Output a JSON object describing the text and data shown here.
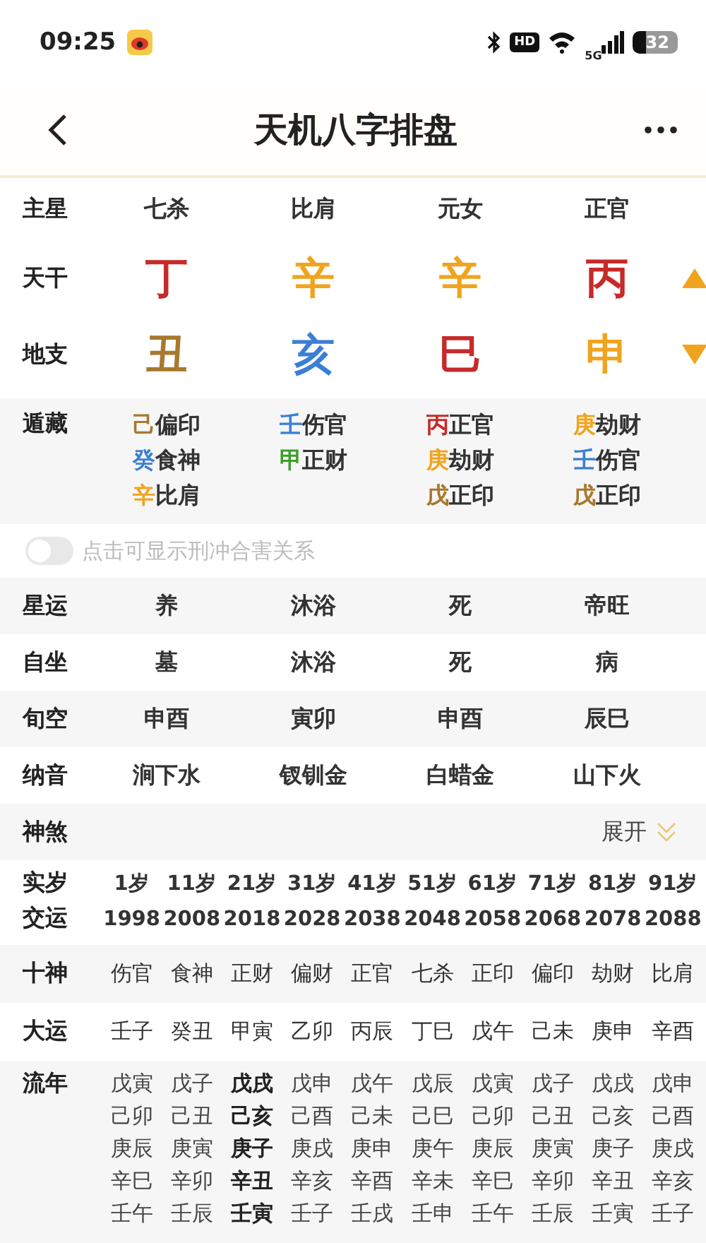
{
  "status_bar": {
    "time": "09:25",
    "hd": "HD",
    "network": "5G",
    "battery": "32"
  },
  "header": {
    "title": "天机八字排盘"
  },
  "pillars": {
    "main_star": {
      "label": "主星",
      "values": [
        "七杀",
        "比肩",
        "元女",
        "正官"
      ]
    },
    "stems": {
      "label": "天干",
      "items": [
        {
          "char": "丁",
          "color": "#c62a2a"
        },
        {
          "char": "辛",
          "color": "#f0a41e"
        },
        {
          "char": "辛",
          "color": "#f0a41e"
        },
        {
          "char": "丙",
          "color": "#c62a2a"
        }
      ]
    },
    "branches": {
      "label": "地支",
      "items": [
        {
          "char": "丑",
          "color": "#a8782e"
        },
        {
          "char": "亥",
          "color": "#3b7fd4"
        },
        {
          "char": "巳",
          "color": "#c62a2a"
        },
        {
          "char": "申",
          "color": "#f0a41e"
        }
      ]
    },
    "hidden": {
      "label": "遁藏",
      "columns": [
        [
          {
            "stem": "己",
            "color": "#a8782e",
            "god": "偏印"
          },
          {
            "stem": "癸",
            "color": "#3b7fd4",
            "god": "食神"
          },
          {
            "stem": "辛",
            "color": "#f0a41e",
            "god": "比肩"
          }
        ],
        [
          {
            "stem": "壬",
            "color": "#3b7fd4",
            "god": "伤官"
          },
          {
            "stem": "甲",
            "color": "#3f9f2a",
            "god": "正财"
          }
        ],
        [
          {
            "stem": "丙",
            "color": "#c62a2a",
            "god": "正官"
          },
          {
            "stem": "庚",
            "color": "#f0a41e",
            "god": "劫财"
          },
          {
            "stem": "戊",
            "color": "#a8782e",
            "god": "正印"
          }
        ],
        [
          {
            "stem": "庚",
            "color": "#f0a41e",
            "god": "劫财"
          },
          {
            "stem": "壬",
            "color": "#3b7fd4",
            "god": "伤官"
          },
          {
            "stem": "戊",
            "color": "#a8782e",
            "god": "正印"
          }
        ]
      ]
    }
  },
  "relation_toggle": {
    "label": "点击可显示刑冲合害关系",
    "on": false
  },
  "info_rows": [
    {
      "label": "星运",
      "values": [
        "养",
        "沐浴",
        "死",
        "帝旺"
      ]
    },
    {
      "label": "自坐",
      "values": [
        "墓",
        "沐浴",
        "死",
        "病"
      ]
    },
    {
      "label": "旬空",
      "values": [
        "申酉",
        "寅卯",
        "申酉",
        "辰巳"
      ]
    },
    {
      "label": "纳音",
      "values": [
        "涧下水",
        "钗钏金",
        "白蜡金",
        "山下火"
      ]
    }
  ],
  "shensha": {
    "label": "神煞",
    "action": "展开",
    "expanded": false
  },
  "luck": {
    "age": {
      "label": "实岁",
      "values": [
        "1岁",
        "11岁",
        "21岁",
        "31岁",
        "41岁",
        "51岁",
        "61岁",
        "71岁",
        "81岁",
        "91岁"
      ]
    },
    "start": {
      "label": "交运",
      "values": [
        "1998",
        "2008",
        "2018",
        "2028",
        "2038",
        "2048",
        "2058",
        "2068",
        "2078",
        "2088"
      ]
    },
    "gods": {
      "label": "十神",
      "values": [
        "伤官",
        "食神",
        "正财",
        "偏财",
        "正官",
        "七杀",
        "正印",
        "偏印",
        "劫财",
        "比肩"
      ]
    },
    "dayun": {
      "label": "大运",
      "values": [
        "壬子",
        "癸丑",
        "甲寅",
        "乙卯",
        "丙辰",
        "丁巳",
        "戊午",
        "己未",
        "庚申",
        "辛酉"
      ]
    },
    "liunian": {
      "label": "流年",
      "columns": [
        {
          "selected": false,
          "years": [
            "戊寅",
            "己卯",
            "庚辰",
            "辛巳",
            "壬午"
          ]
        },
        {
          "selected": false,
          "years": [
            "戊子",
            "己丑",
            "庚寅",
            "辛卯",
            "壬辰"
          ]
        },
        {
          "selected": true,
          "years": [
            "戊戌",
            "己亥",
            "庚子",
            "辛丑",
            "壬寅"
          ]
        },
        {
          "selected": false,
          "years": [
            "戊申",
            "己酉",
            "庚戌",
            "辛亥",
            "壬子"
          ]
        },
        {
          "selected": false,
          "years": [
            "戊午",
            "己未",
            "庚申",
            "辛酉",
            "壬戌"
          ]
        },
        {
          "selected": false,
          "years": [
            "戊辰",
            "己巳",
            "庚午",
            "辛未",
            "壬申"
          ]
        },
        {
          "selected": false,
          "years": [
            "戊寅",
            "己卯",
            "庚辰",
            "辛巳",
            "壬午"
          ]
        },
        {
          "selected": false,
          "years": [
            "戊子",
            "己丑",
            "庚寅",
            "辛卯",
            "壬辰"
          ]
        },
        {
          "selected": false,
          "years": [
            "戊戌",
            "己亥",
            "庚子",
            "辛丑",
            "壬寅"
          ]
        },
        {
          "selected": false,
          "years": [
            "戊申",
            "己酉",
            "庚戌",
            "辛亥",
            "壬子"
          ]
        }
      ]
    }
  }
}
